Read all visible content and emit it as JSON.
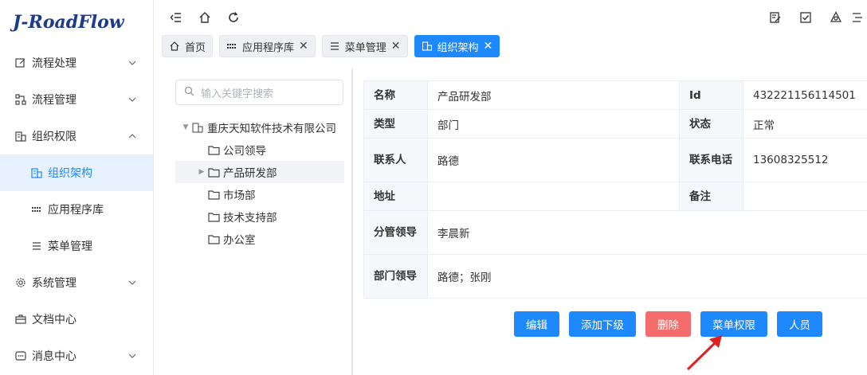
{
  "app": {
    "logo": "J-RoadFlow"
  },
  "sidebar": {
    "items": [
      {
        "label": "流程处理",
        "icon": "edit-icon",
        "expand": "down"
      },
      {
        "label": "流程管理",
        "icon": "flow-icon",
        "expand": "down"
      },
      {
        "label": "组织权限",
        "icon": "org-icon",
        "expand": "up"
      },
      {
        "label": "组织架构",
        "icon": "org-icon",
        "sub": true,
        "active": true
      },
      {
        "label": "应用程序库",
        "icon": "grid-icon",
        "sub": true
      },
      {
        "label": "菜单管理",
        "icon": "menu-icon",
        "sub": true
      },
      {
        "label": "系统管理",
        "icon": "gear-icon",
        "expand": "down"
      },
      {
        "label": "文档中心",
        "icon": "briefcase-icon"
      },
      {
        "label": "消息中心",
        "icon": "message-icon",
        "expand": "down"
      }
    ]
  },
  "tabs": [
    {
      "label": "首页",
      "icon": "home-icon",
      "closable": false
    },
    {
      "label": "应用程序库",
      "icon": "grid-icon",
      "closable": true
    },
    {
      "label": "菜单管理",
      "icon": "menu-icon",
      "closable": true
    },
    {
      "label": "组织架构",
      "icon": "org-icon",
      "closable": true,
      "active": true
    }
  ],
  "tree": {
    "search_placeholder": "输入关键字搜索",
    "root": "重庆天知软件技术有限公司",
    "children": [
      "公司领导",
      "产品研发部",
      "市场部",
      "技术支持部",
      "办公室"
    ]
  },
  "detail": {
    "rows": [
      {
        "k1": "名称",
        "v1": "产品研发部",
        "k2": "Id",
        "v2": "432221156114501"
      },
      {
        "k1": "类型",
        "v1": "部门",
        "k2": "状态",
        "v2": "正常"
      },
      {
        "k1": "联系人",
        "v1": "路德",
        "k2": "联系电话",
        "v2": "13608325512"
      },
      {
        "k1": "地址",
        "v1": "",
        "k2": "备注",
        "v2": ""
      },
      {
        "k1": "分管领导",
        "v1": "李晨新"
      },
      {
        "k1": "部门领导",
        "v1": "路德；张刚"
      }
    ]
  },
  "actions": {
    "edit": "编辑",
    "add_child": "添加下级",
    "delete": "删除",
    "menu_perm": "菜单权限",
    "people": "人员"
  },
  "colors": {
    "primary": "#1e88ff",
    "danger": "#f56c6c",
    "logo": "#1c3b8a",
    "arrow": "#e02020"
  }
}
